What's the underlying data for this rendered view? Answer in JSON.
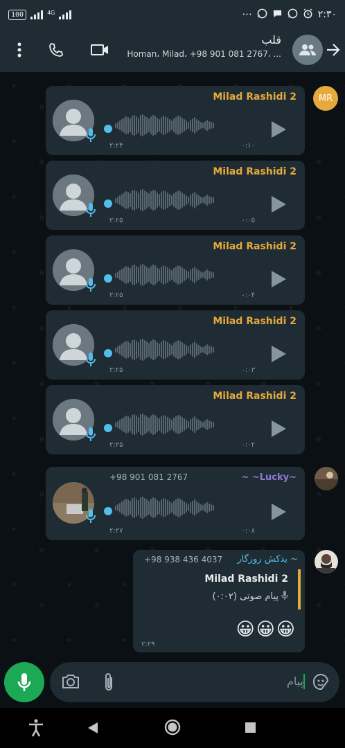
{
  "status": {
    "battery": "100",
    "network": "4G",
    "time": "۲:۳۰",
    "more": "···"
  },
  "header": {
    "title": "قلب",
    "subtitle": "Homan، Milad، +98 901 081 2767، ..."
  },
  "sender_avatar_initials": "MR",
  "voice_messages": [
    {
      "sender": "Milad Rashidi 2",
      "duration": "۰:۱۰",
      "time": "۲:۲۴"
    },
    {
      "sender": "Milad Rashidi 2",
      "duration": "۰:۰۵",
      "time": "۲:۲۵"
    },
    {
      "sender": "Milad Rashidi 2",
      "duration": "۰:۰۴",
      "time": "۲:۲۵"
    },
    {
      "sender": "Milad Rashidi 2",
      "duration": "۰:۰۳",
      "time": "۲:۲۵"
    },
    {
      "sender": "Milad Rashidi 2",
      "duration": "۰:۰۲",
      "time": "۲:۲۵"
    }
  ],
  "lucky_message": {
    "sender": "~ ~Lucky~",
    "phone": "+98 901 081 2767",
    "duration": "۰:۰۸",
    "time": "۲:۲۷"
  },
  "reply_message": {
    "sender": "~ یدکش روزگار",
    "phone": "+98 938 436 4037",
    "quoted_sender": "Milad Rashidi 2",
    "quoted_text": "پیام صوتی (۰:۰۲)",
    "body": "😀😀😀",
    "time": "۲:۲۹"
  },
  "input": {
    "placeholder": "پیام"
  },
  "colors": {
    "accent_green": "#1da855",
    "sender_orange": "#e5a93c",
    "lucky_purple": "#8e7bd6",
    "reply_blue": "#53bdeb",
    "bubble": "#1f2c33"
  }
}
